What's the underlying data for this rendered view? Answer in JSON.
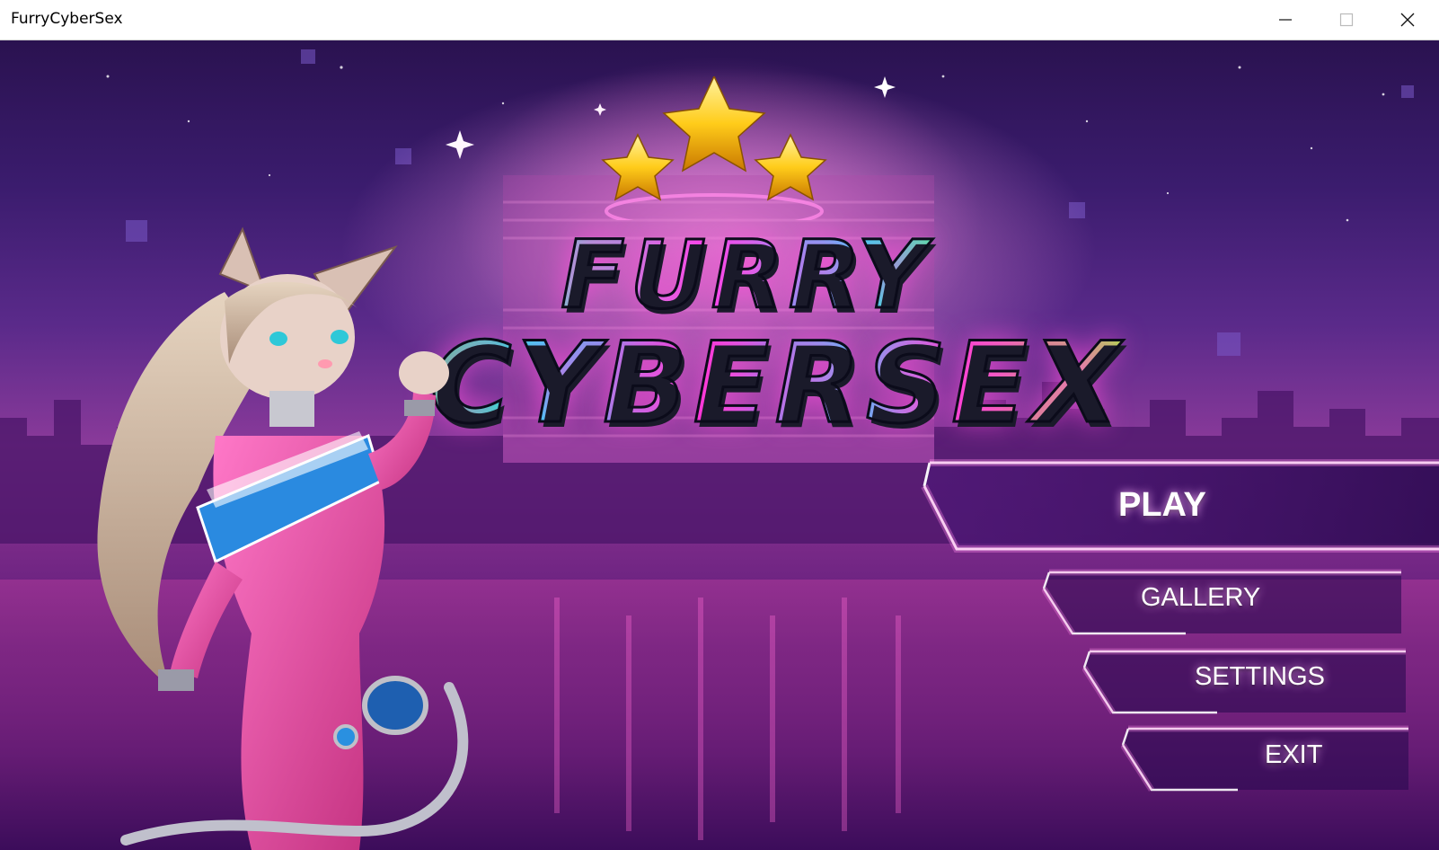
{
  "window": {
    "title": "FurryCyberSex",
    "controls": {
      "minimize": "—",
      "maximize": "☐",
      "close": "✕"
    }
  },
  "logo": {
    "line1": "FURRY",
    "line2": "CYBERSEX",
    "stars": [
      "star-icon",
      "star-icon",
      "star-icon"
    ]
  },
  "menu": {
    "play": "PLAY",
    "gallery": "GALLERY",
    "settings": "SETTINGS",
    "exit": "EXIT"
  },
  "colors": {
    "accent_pink": "#ff3df0",
    "accent_cyan": "#22e0ff",
    "accent_green": "#6bff4a",
    "button_glow": "#ffb4ff"
  }
}
